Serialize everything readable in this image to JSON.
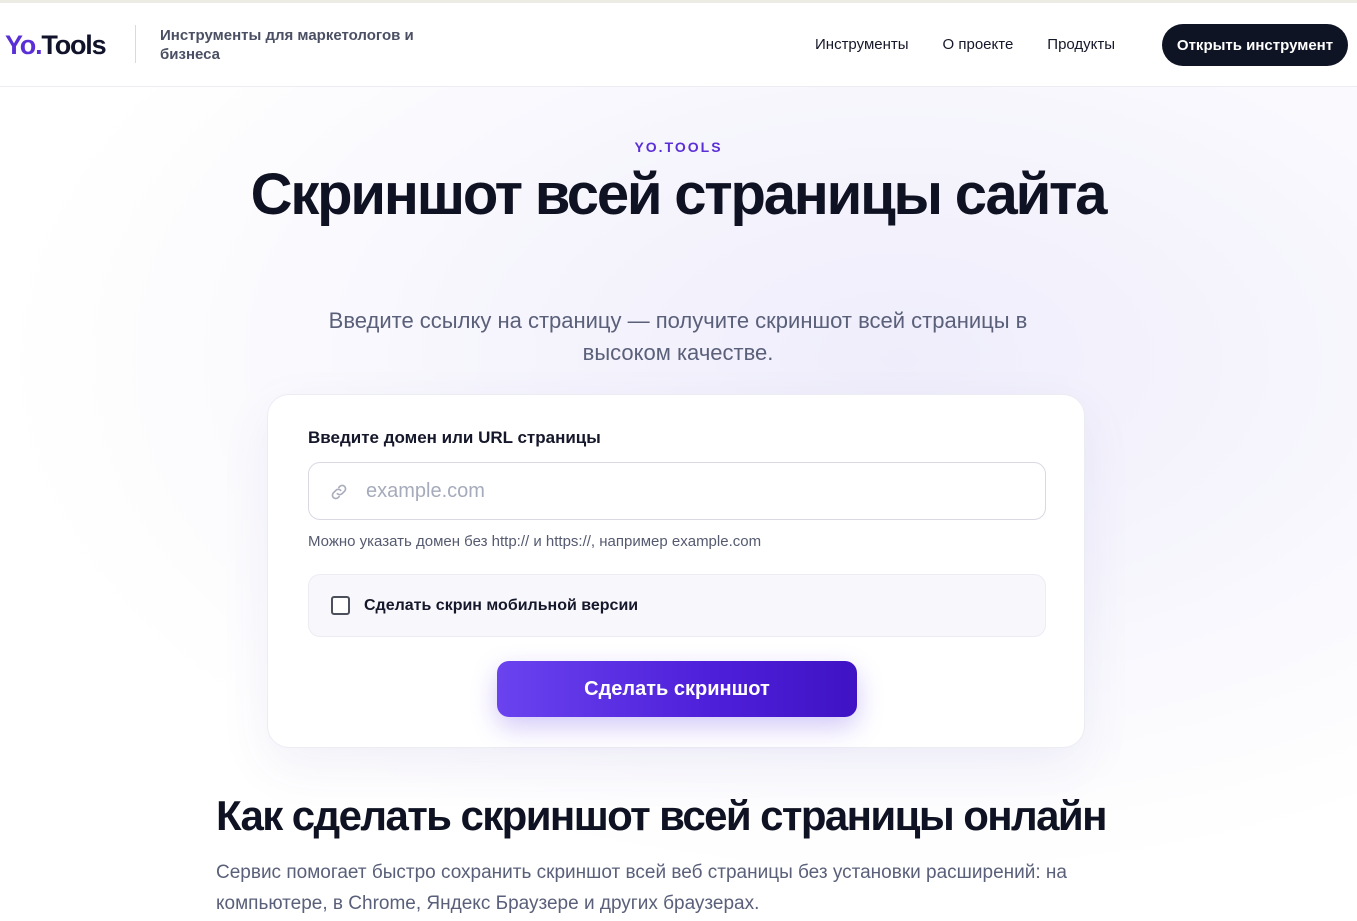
{
  "header": {
    "logo_yo": "Yo",
    "logo_dot": ".",
    "logo_tools": "Tools",
    "tagline": "Инструменты для маркетологов и бизнеса",
    "nav": [
      "Инструменты",
      "О проекте",
      "Продукты"
    ],
    "cta_label": "Открыть инструмент"
  },
  "hero": {
    "eyebrow": "YO.TOOLS",
    "title": "Скриншот всей страницы сайта",
    "subtitle": "Введите ссылку на страницу — получите скриншот всей страницы в высоком качестве."
  },
  "form": {
    "label": "Введите домен или URL страницы",
    "input_value": "",
    "placeholder": "example.com",
    "hint": "Можно указать домен без http:// и https://, например example.com",
    "mobile_option_label": "Сделать скрин мобильной версии",
    "mobile_option_checked": false,
    "submit_label": "Сделать скриншот",
    "link_icon": "link-icon"
  },
  "section": {
    "title": "Как сделать скриншот всей страницы онлайн",
    "text": "Сервис помогает быстро сохранить скриншот всей веб страницы без установки расширений: на компьютере, в Chrome, Яндекс Браузере и других браузерах."
  },
  "colors": {
    "accent": "#5b2fd6",
    "button_dark": "#0f1424",
    "button_gradient_start": "#6a43ef",
    "button_gradient_end": "#3f13c4"
  }
}
